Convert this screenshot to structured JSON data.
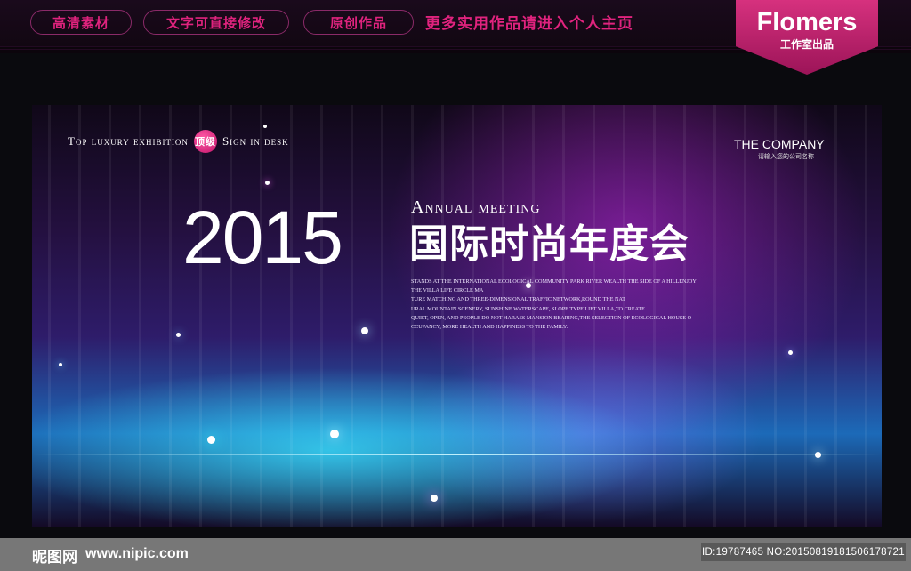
{
  "topbar": {
    "pills": [
      "高清素材",
      "文字可直接修改",
      "原创作品"
    ],
    "promo": "更多实用作品请进入个人主页"
  },
  "brand": {
    "name": "Flomers",
    "sub": "工作室出品"
  },
  "banner": {
    "tagline_left": "Top luxury exhibition",
    "badge": "顶级",
    "tagline_right": "Sign in desk",
    "company": "THE COMPANY",
    "company_sub": "请输入您的公司名称",
    "year": "2015",
    "annual": "Annual meeting",
    "title": "国际时尚年度会",
    "body": [
      "STANDS AT THE INTERNATIONAL ECOLOGICAL COMMUNITY PARK RIVER WEALTH THE SIDE OF A HILLENJOY",
      "THE VILLA LIFE CIRCLE MA",
      "TURE MATCHING AND THREE-DIMENSIONAL TRAFFIC NETWORK,ROUND THE NAT",
      "URAL MOUNTAIN SCENERY, SUNSHINE WATERSCAPE, SLOPE TYPE LIFT VILLA,TO CREATE",
      "QUIET, OPEN, AND PEOPLE DO NOT HARASS MANSION BEARING,THE SELECTION OF ECOLOGICAL HOUSE O",
      "CCUPANCY, MORE HEALTH AND HAPPINESS TO THE FAMILY."
    ]
  },
  "footer": {
    "logo": "昵图网",
    "url": "www.nipic.com",
    "id": "ID:19787465 NO:20150819181506178721"
  }
}
